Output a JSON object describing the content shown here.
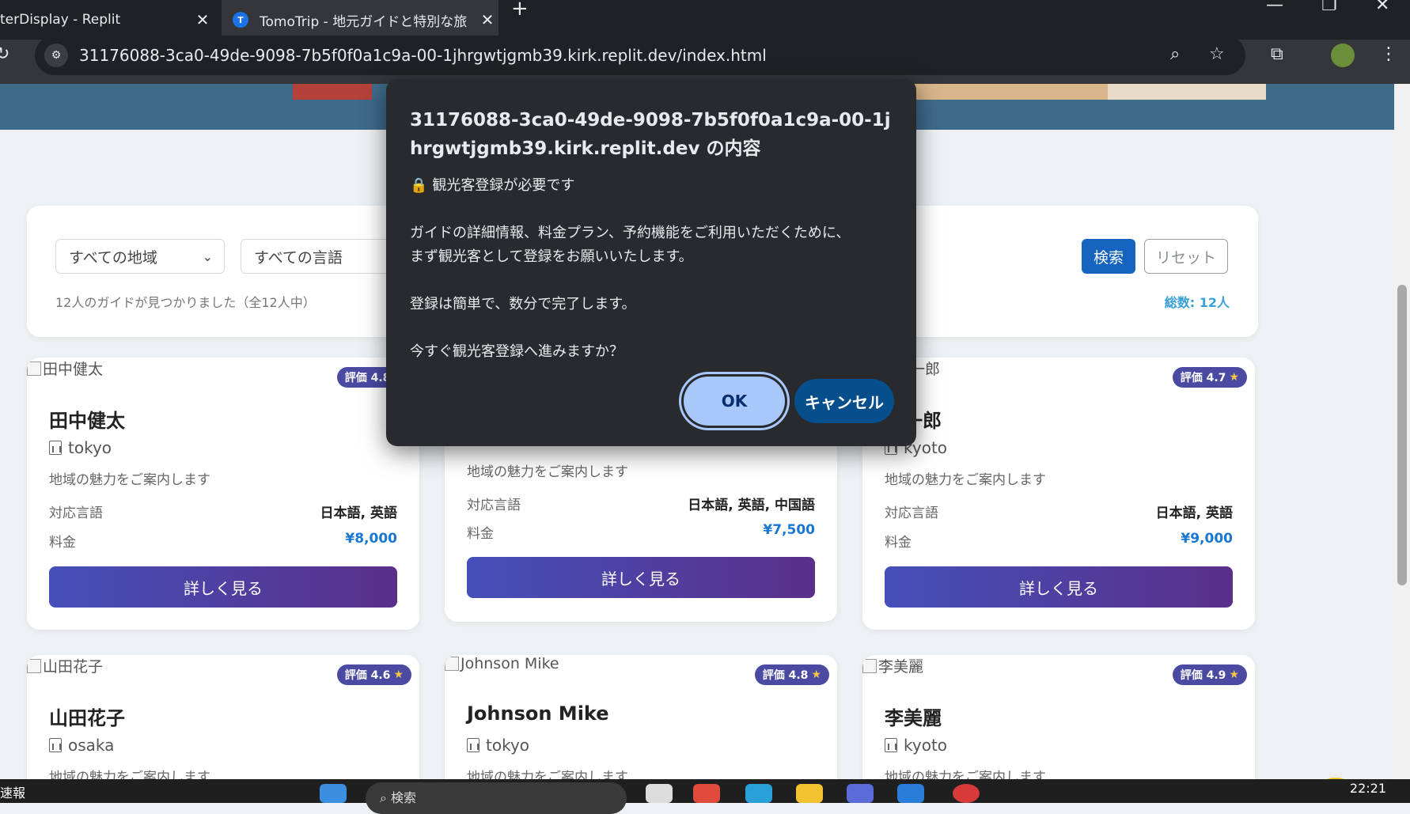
{
  "browser": {
    "inactive_tab_title": "terDisplay - Replit",
    "active_tab_title": "TomoTrip - 地元ガイドと特別な旅",
    "active_tab_favicon": "T",
    "url": "31176088-3ca0-49de-9098-7b5f0f0a1c9a-00-1jhrgwtjgmb39.kirk.replit.dev/index.html"
  },
  "filters": {
    "region": "すべての地域",
    "language": "すべての言語",
    "search_button": "検索",
    "reset_button": "リセット",
    "found_text": "12人のガイドが見つかりました（全12人中）",
    "total_text": "総数: 12人"
  },
  "labels": {
    "languages": "対応言語",
    "fee": "料金",
    "detail_button": "詳しく見る",
    "description": "地域の魅力をご案内します"
  },
  "cards": [
    {
      "photo_alt": "田中健太",
      "rating": "評価 4.8",
      "name": "田中健太",
      "location": "tokyo",
      "languages": "日本語, 英語",
      "price": "¥8,000"
    },
    {
      "photo_alt": "",
      "rating": "",
      "name": "",
      "location": "",
      "languages": "日本語, 英語, 中国語",
      "price": "¥7,500"
    },
    {
      "photo_alt": "一郎",
      "rating": "評価 4.7",
      "name": "木一郎",
      "location": "kyoto",
      "languages": "日本語, 英語",
      "price": "¥9,000"
    },
    {
      "photo_alt": "山田花子",
      "rating": "評価 4.6",
      "name": "山田花子",
      "location": "osaka"
    },
    {
      "photo_alt": "Johnson Mike",
      "rating": "評価 4.8",
      "name": "Johnson Mike",
      "location": "tokyo"
    },
    {
      "photo_alt": "李美麗",
      "rating": "評価 4.9",
      "name": "李美麗",
      "location": "kyoto"
    }
  ],
  "dialog": {
    "title": "31176088-3ca0-49de-9098-7b5f0f0a1c9a-00-1jhrgwtjgmb39.kirk.replit.dev の内容",
    "heading": "観光客登録が必要です",
    "line1": "ガイドの詳細情報、料金プラン、予約機能をご利用いただくために、",
    "line2": "まず観光客として登録をお願いいたします。",
    "line3": "登録は簡単で、数分で完了します。",
    "line4": "今すぐ観光客登録へ進みますか？",
    "ok_button": "OK",
    "cancel_button": "キャンセル"
  },
  "taskbar": {
    "left_text": "速報",
    "search_placeholder": "検索",
    "clock": "22:21"
  },
  "colors": {
    "accent": "#1565c0",
    "badge": "#4a4aa3",
    "price": "#1976d2",
    "dialog_bg": "#292a2d",
    "ok_button": "#a8c7fa"
  }
}
